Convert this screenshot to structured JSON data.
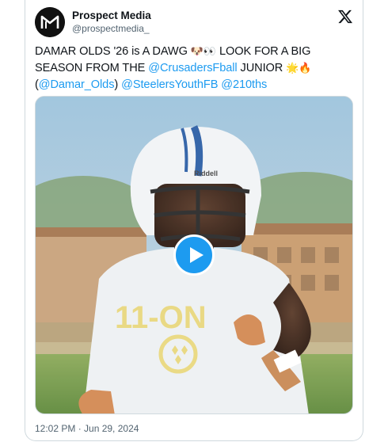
{
  "author": {
    "display_name": "Prospect Media",
    "handle": "@prospectmedia_",
    "avatar_icon": "prospect-media-logo"
  },
  "tweet": {
    "segments": [
      {
        "type": "text",
        "value": "DAMAR OLDS '26 is A DAWG "
      },
      {
        "type": "emoji",
        "value": "🐶👀"
      },
      {
        "type": "text",
        "value": " LOOK FOR A BIG SEASON FROM THE "
      },
      {
        "type": "mention",
        "value": "@CrusadersFball"
      },
      {
        "type": "text",
        "value": " JUNIOR "
      },
      {
        "type": "emoji",
        "value": "🌟🔥"
      },
      {
        "type": "text",
        "value": " ("
      },
      {
        "type": "mention",
        "value": "@Damar_Olds"
      },
      {
        "type": "text",
        "value": ") "
      },
      {
        "type": "mention",
        "value": "@SteelersYouthFB"
      },
      {
        "type": "text",
        "value": " "
      },
      {
        "type": "mention",
        "value": "@210ths"
      }
    ]
  },
  "media": {
    "type": "video",
    "helmet_brand": "Riddell",
    "jersey_text": "11-ON"
  },
  "timestamp": "12:02 PM · Jun 29, 2024",
  "colors": {
    "accent": "#1d9bf0",
    "text": "#0f1419",
    "secondary": "#536471",
    "border": "#cfd9de"
  },
  "icons": {
    "brand": "x-logo-icon",
    "play": "play-icon"
  }
}
